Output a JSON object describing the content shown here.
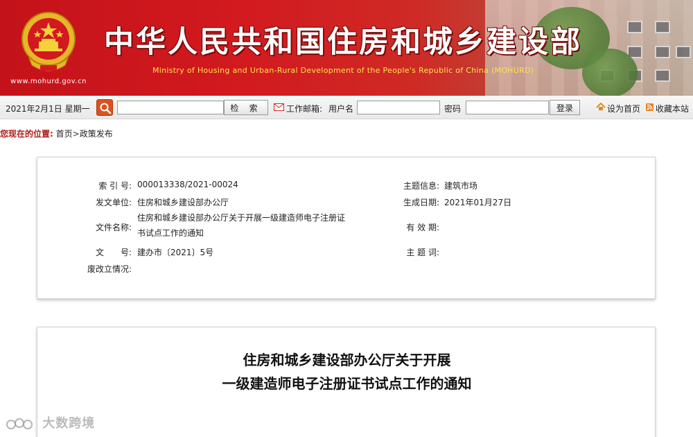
{
  "banner": {
    "title_cn": "中华人民共和国住房和城乡建设部",
    "title_en": "Ministry of Housing and Urban-Rural Development of the People's Republic of China (MOHURD)",
    "site_url": "www.mohurd.gov.cn"
  },
  "toolbar": {
    "date": "2021年2月1日 星期一",
    "search_value": "",
    "search_button": "检 索",
    "mail_label": "工作邮箱:",
    "user_label": "用户名",
    "user_value": "",
    "password_label": "密码",
    "password_value": "",
    "login_button": "登录",
    "home_link": "设为首页",
    "favorite_link": "收藏本站"
  },
  "breadcrumb": {
    "label": "您现在的位置:",
    "home": "首页",
    "separator": ">",
    "section": "政策发布"
  },
  "info": {
    "index_key": "索 引 号:",
    "index_val": "000013338/2021-00024",
    "topic_key": "主题信息:",
    "topic_val": "建筑市场",
    "issuer_key": "发文单位:",
    "issuer_val": "住房和城乡建设部办公厅",
    "date_key": "生成日期:",
    "date_val": "2021年01月27日",
    "docname_key": "文件名称:",
    "docname_val": "住房和城乡建设部办公厅关于开展一级建造师电子注册证书试点工作的通知",
    "validity_key": "有 效 期:",
    "validity_val": "",
    "docno_key": "文　　号:",
    "docno_val": "建办市〔2021〕5号",
    "keywords_key": "主 题 词:",
    "keywords_val": "",
    "status_key": "废改立情况:",
    "status_val": ""
  },
  "article": {
    "title_line1": "住房和城乡建设部办公厅关于开展",
    "title_line2": "一级建造师电子注册证书试点工作的通知"
  },
  "watermark": {
    "text": "大数跨境"
  },
  "colors": {
    "banner_red": "#c4121a",
    "title_en_yellow": "#ffe34d",
    "breadcrumb_label": "#b11b1b",
    "search_orange": "#d9531e"
  }
}
